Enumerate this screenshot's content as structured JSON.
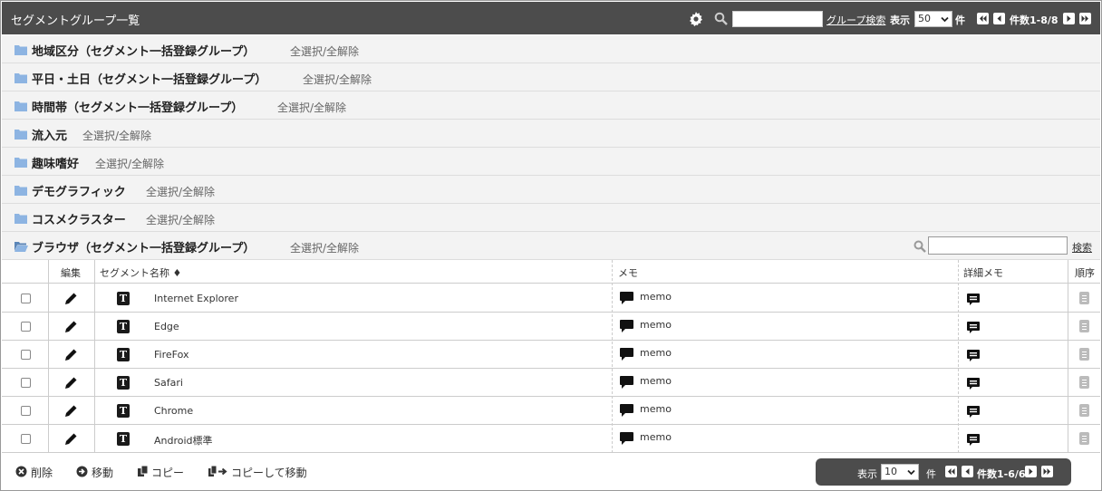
{
  "header": {
    "title": "セグメントグループ一覧",
    "search_placeholder": "",
    "search_link": "グループ検索",
    "display_label": "表示",
    "per_page": "50",
    "unit": "件",
    "count": "件数1-8/8"
  },
  "groups": [
    {
      "name": "地域区分（セグメント一括登録グループ）",
      "select": "全選択/全解除"
    },
    {
      "name": "平日・土日（セグメント一括登録グループ）",
      "select": "全選択/全解除"
    },
    {
      "name": "時間帯（セグメント一括登録グループ）",
      "select": "全選択/全解除"
    },
    {
      "name": "流入元",
      "select": "全選択/全解除"
    },
    {
      "name": "趣味嗜好",
      "select": "全選択/全解除"
    },
    {
      "name": "デモグラフィック",
      "select": "全選択/全解除"
    },
    {
      "name": "コスメクラスター",
      "select": "全選択/全解除"
    }
  ],
  "open_group": {
    "name": "ブラウザ（セグメント一括登録グループ）",
    "select": "全選択/全解除",
    "search_link": "検索"
  },
  "table": {
    "headers": {
      "edit": "編集",
      "name": "セグメント名称 ♦",
      "memo": "メモ",
      "detail_memo": "詳細メモ",
      "order": "順序"
    },
    "rows": [
      {
        "type_icon": "T",
        "name": "Internet Explorer",
        "memo": "memo"
      },
      {
        "type_icon": "T",
        "name": "Edge",
        "memo": "memo"
      },
      {
        "type_icon": "T",
        "name": "FireFox",
        "memo": "memo"
      },
      {
        "type_icon": "T",
        "name": "Safari",
        "memo": "memo"
      },
      {
        "type_icon": "T",
        "name": "Chrome",
        "memo": "memo"
      },
      {
        "type_icon": "T",
        "name": "Android標準",
        "memo": "memo"
      }
    ]
  },
  "footer": {
    "delete": "削除",
    "move": "移動",
    "copy": "コピー",
    "copy_move": "コピーして移動",
    "display_label": "表示",
    "per_page": "10",
    "unit": "件",
    "count": "件数1-6/6"
  },
  "colors": {
    "header_bg": "#4c4c4c",
    "group_bg": "#f3f3f3",
    "folder": "#8db4e2"
  }
}
